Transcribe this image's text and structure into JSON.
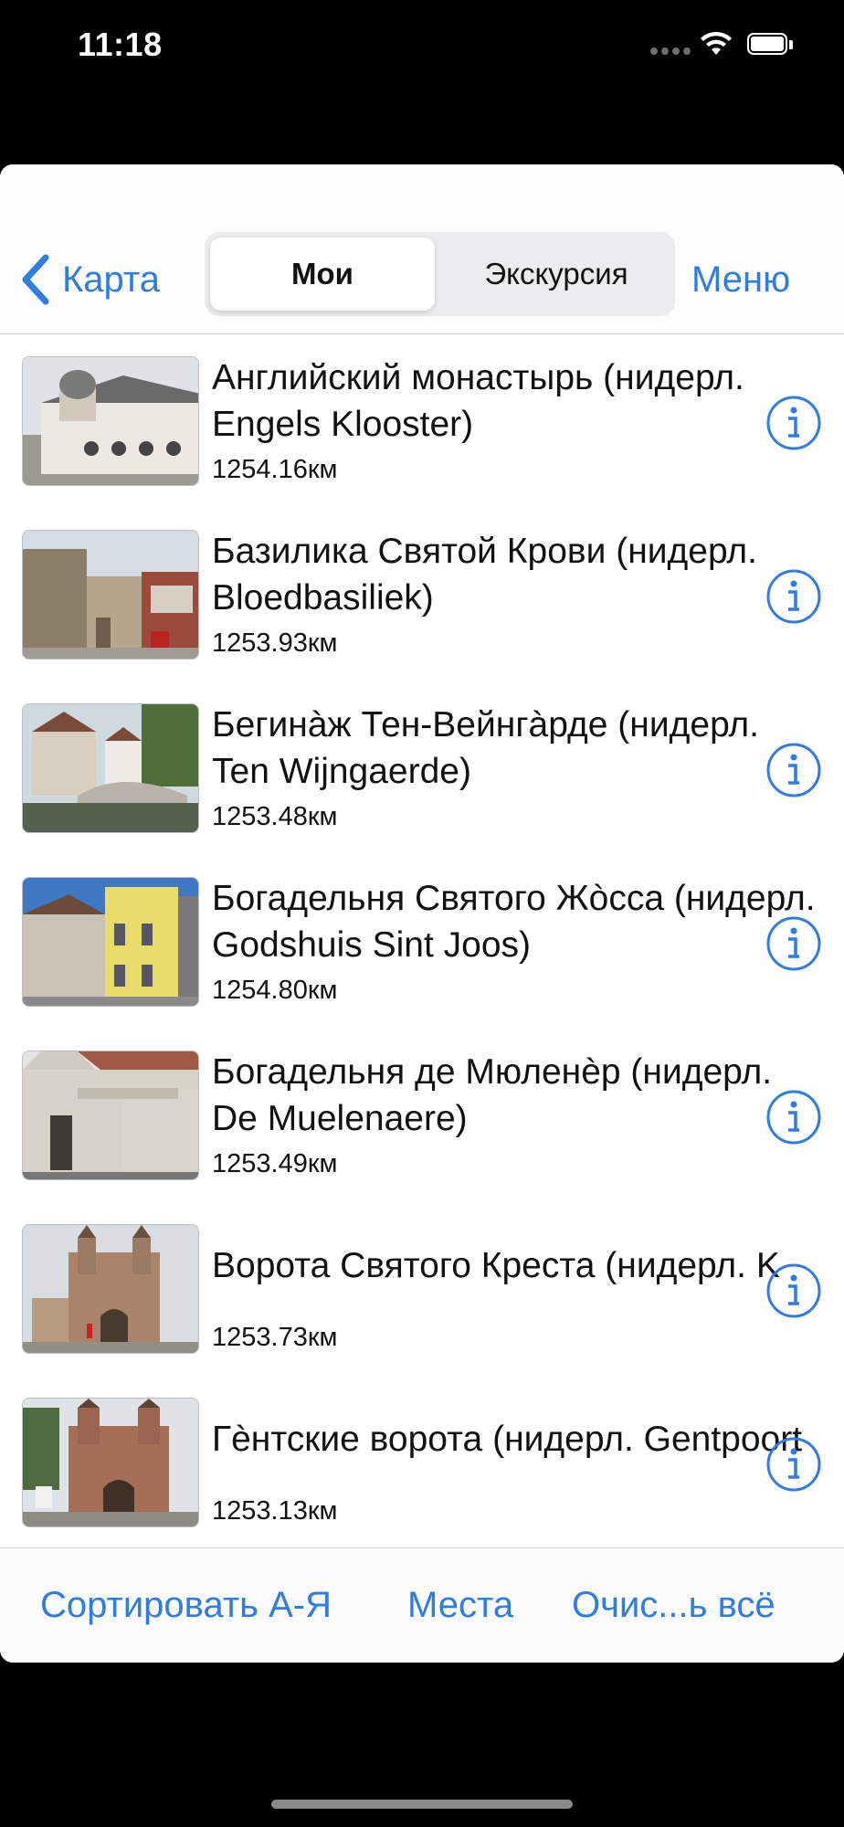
{
  "status": {
    "time": "11:18"
  },
  "nav": {
    "back_label": "Карта",
    "segments": [
      "Мои",
      "Экскурсия"
    ],
    "selected_segment": "Мои",
    "menu_label": "Меню"
  },
  "list": {
    "items": [
      {
        "title1": "Английский монастырь (нидерл.",
        "title2": "Engels Klooster)",
        "distance": "1254.16км"
      },
      {
        "title1": "Базилика Святой Крови (нидерл.",
        "title2": "Bloedbasiliek)",
        "distance": "1253.93км"
      },
      {
        "title1": "Бегинàж Тен-Вейнгàрде (нидерл.",
        "title2": "Ten Wijngaerde)",
        "distance": "1253.48км"
      },
      {
        "title1": "Богадельня Святого Жòсса (нидерл.",
        "title2": "Godshuis Sint Joos)",
        "distance": "1254.80км"
      },
      {
        "title1": "Богадельня де Мюленèр (нидерл.",
        "title2": "De Muelenaere)",
        "distance": "1253.49км"
      },
      {
        "title1": "Ворота Святого Креста (нидерл. K",
        "title2": "",
        "distance": "1253.73км"
      },
      {
        "title1": "Гèнтские ворота (нидерл. Gentpoort",
        "title2": "",
        "distance": "1253.13км"
      }
    ]
  },
  "toolbar": {
    "sort_label": "Сортировать А-Я",
    "places_label": "Места",
    "clear_label": "Очис...ь всё"
  },
  "colors": {
    "accent": "#2f7de1"
  },
  "icons": {
    "back": "chevron-left-icon",
    "info": "info-circle-icon",
    "wifi": "wifi-icon",
    "battery": "battery-icon"
  }
}
